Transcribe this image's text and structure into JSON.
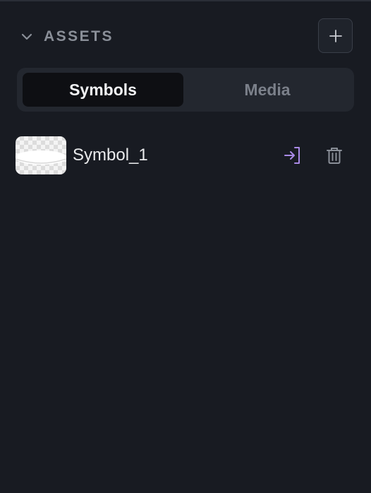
{
  "header": {
    "title": "ASSETS",
    "collapse_icon": "chevron-down-icon",
    "add_icon": "plus-icon"
  },
  "tabs": [
    {
      "label": "Symbols",
      "active": true
    },
    {
      "label": "Media",
      "active": false
    }
  ],
  "assets": [
    {
      "name": "Symbol_1",
      "thumbnail": "symbol-thumbnail",
      "actions": [
        "enter-symbol-icon",
        "trash-icon"
      ]
    }
  ],
  "colors": {
    "background": "#181b22",
    "accent": "#a98ae6",
    "muted_text": "#8a8f98",
    "text": "#e9eaec"
  }
}
